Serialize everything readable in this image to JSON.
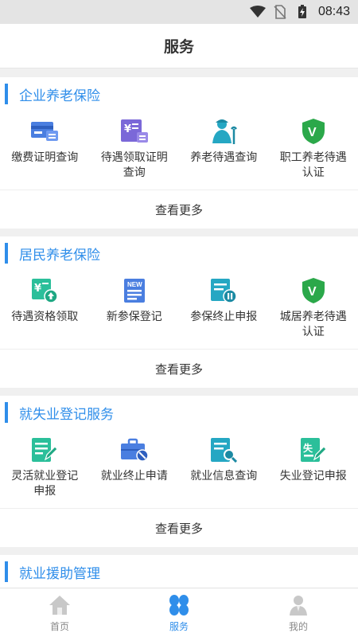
{
  "status_bar": {
    "time": "08:43"
  },
  "header": {
    "title": "服务"
  },
  "sections": [
    {
      "title": "企业养老保险",
      "items": [
        {
          "label": "缴费证明查询",
          "icon": "payment-card-icon"
        },
        {
          "label": "待遇领取证明查询",
          "icon": "yuan-certificate-icon"
        },
        {
          "label": "养老待遇查询",
          "icon": "elderly-person-icon"
        },
        {
          "label": "职工养老待遇认证",
          "icon": "shield-v-icon"
        }
      ],
      "more_label": "查看更多"
    },
    {
      "title": "居民养老保险",
      "items": [
        {
          "label": "待遇资格领取",
          "icon": "yuan-upload-icon"
        },
        {
          "label": "新参保登记",
          "icon": "new-document-icon"
        },
        {
          "label": "参保终止申报",
          "icon": "document-pause-icon"
        },
        {
          "label": "城居养老待遇认证",
          "icon": "shield-v-icon"
        }
      ],
      "more_label": "查看更多"
    },
    {
      "title": "就失业登记服务",
      "items": [
        {
          "label": "灵活就业登记申报",
          "icon": "document-edit-icon"
        },
        {
          "label": "就业终止申请",
          "icon": "briefcase-stop-icon"
        },
        {
          "label": "就业信息查询",
          "icon": "document-search-icon"
        },
        {
          "label": "失业登记申报",
          "icon": "unemployment-document-icon"
        }
      ],
      "more_label": "查看更多"
    },
    {
      "title": "就业援助管理",
      "items": [],
      "more_label": ""
    }
  ],
  "tabs": [
    {
      "label": "首页",
      "icon": "home-icon",
      "active": false
    },
    {
      "label": "服务",
      "icon": "services-grid-icon",
      "active": true
    },
    {
      "label": "我的",
      "icon": "user-icon",
      "active": false
    }
  ],
  "colors": {
    "accent": "#2f8eea",
    "blue_icon": "#4a7ee0",
    "purple_icon": "#7b68d8",
    "green_icon": "#2bbf9a",
    "teal_icon": "#25a7c3",
    "shield_green": "#2ba84a"
  }
}
